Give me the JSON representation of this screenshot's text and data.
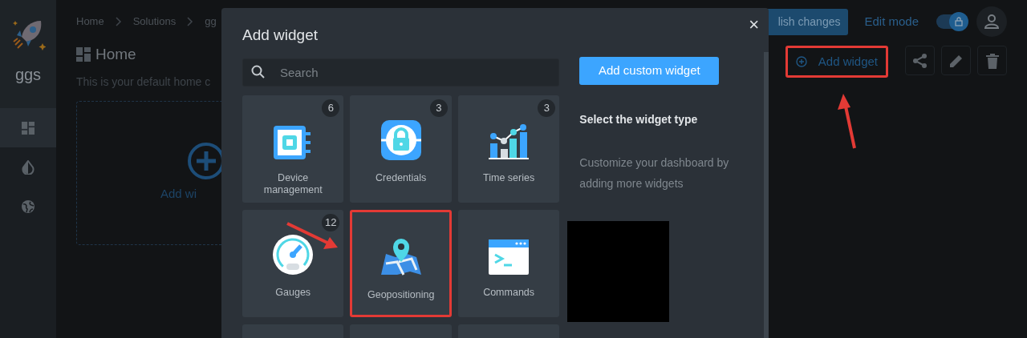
{
  "sidebar": {
    "brand": "ggs",
    "items": [
      {
        "kind": "dashboard",
        "selected": true
      },
      {
        "kind": "contrast",
        "selected": false
      },
      {
        "kind": "globe",
        "selected": false
      }
    ]
  },
  "breadcrumbs": [
    "Home",
    "Solutions",
    "gg"
  ],
  "page": {
    "title": "Home",
    "description": "This is your default home c",
    "empty_action": "Add wi"
  },
  "toolbar": {
    "publish": "lish changes",
    "edit_mode": "Edit mode",
    "edit_mode_on": true,
    "add_widget": "Add widget",
    "add_widget_highlighted": true
  },
  "dialog": {
    "title": "Add widget",
    "close": "×",
    "search": {
      "placeholder": "Search"
    },
    "widgets": [
      {
        "kind": "device",
        "label": "Device management",
        "count": "6",
        "highlighted": false
      },
      {
        "kind": "credentials",
        "label": "Credentials",
        "count": "3",
        "highlighted": false
      },
      {
        "kind": "timeseries",
        "label": "Time series",
        "count": "3",
        "highlighted": false
      },
      {
        "kind": "gauge",
        "label": "Gauges",
        "count": "12",
        "highlighted": false
      },
      {
        "kind": "geo",
        "label": "Geopositioning",
        "highlighted": true
      },
      {
        "kind": "commands",
        "label": "Commands",
        "highlighted": false
      },
      {
        "kind": "cut"
      },
      {
        "kind": "cut"
      },
      {
        "kind": "cut"
      }
    ],
    "custom_button": "Add custom widget",
    "heading": "Select the widget type",
    "hint": "Customize your dashboard by adding more widgets"
  }
}
